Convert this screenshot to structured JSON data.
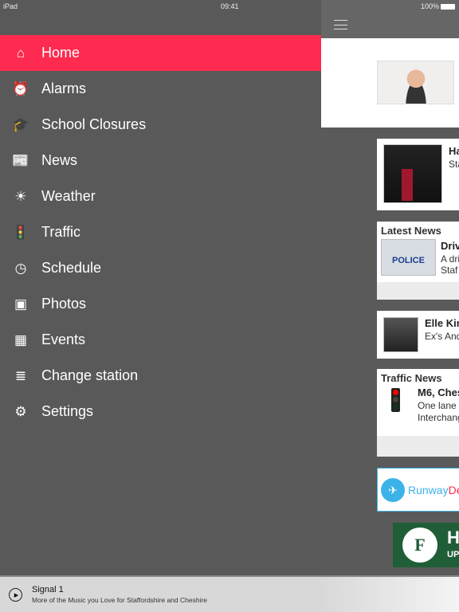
{
  "status": {
    "device": "iPad",
    "time": "09:41",
    "battery": "100%"
  },
  "menu": {
    "items": [
      {
        "label": "Home",
        "icon": "home-icon",
        "glyph": "⌂"
      },
      {
        "label": "Alarms",
        "icon": "alarm-clock-icon",
        "glyph": "⏰"
      },
      {
        "label": "School Closures",
        "icon": "graduation-cap-icon",
        "glyph": "🎓"
      },
      {
        "label": "News",
        "icon": "newspaper-icon",
        "glyph": "📰"
      },
      {
        "label": "Weather",
        "icon": "sun-icon",
        "glyph": "☀"
      },
      {
        "label": "Traffic",
        "icon": "traffic-light-icon",
        "glyph": "🚦"
      },
      {
        "label": "Schedule",
        "icon": "clock-icon",
        "glyph": "◷"
      },
      {
        "label": "Photos",
        "icon": "photos-icon",
        "glyph": "▣"
      },
      {
        "label": "Events",
        "icon": "calendar-icon",
        "glyph": "▦"
      },
      {
        "label": "Change station",
        "icon": "playlist-play-icon",
        "glyph": "≣"
      },
      {
        "label": "Settings",
        "icon": "gears-icon",
        "glyph": "⚙"
      }
    ]
  },
  "colors": {
    "accent": "#fe2a4f",
    "menu_bg": "#595959"
  },
  "cards": {
    "now_playing": {
      "title": "Ha",
      "sub": "Sta"
    },
    "news": {
      "section": "Latest News",
      "title": "Driv",
      "line1": "A dri",
      "line2": "Staf"
    },
    "song": {
      "title": "Elle Kin",
      "sub": "Ex's And"
    },
    "traffic": {
      "section": "Traffic News",
      "title": "M6, Ches",
      "line1": "One lane",
      "line2": "Interchang"
    },
    "ad1": {
      "text1": "Runway",
      "text2": "De"
    },
    "ad2": {
      "big": "H",
      "small": "UP",
      "logo": "F"
    }
  },
  "player": {
    "station": "Signal 1",
    "tagline": "More of the Music you Love for Staffordshire and Cheshire"
  }
}
